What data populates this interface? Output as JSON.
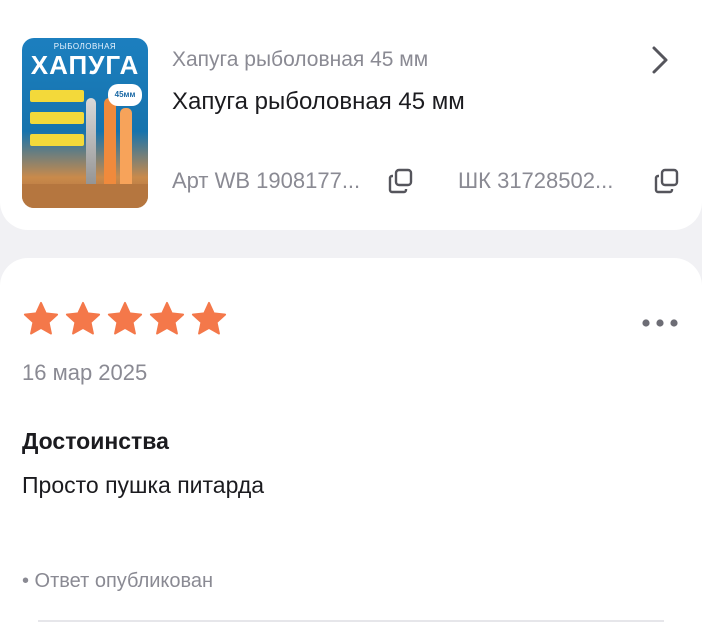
{
  "product": {
    "image_alt_brand_top": "РЫБОЛОВНАЯ",
    "image_alt_brand": "ХАПУГА",
    "image_alt_size": "45мм",
    "subtitle": "Хапуга рыболовная 45 мм",
    "title": "Хапуга рыболовная 45 мм",
    "art_label": "Арт WB 1908177...",
    "shk_label": "ШК 31728502...",
    "chevron_icon": "chevron-right-icon",
    "copy_icon": "copy-icon"
  },
  "review": {
    "rating": 5,
    "rating_max": 5,
    "star_color": "#f4784a",
    "date": "16 мар 2025",
    "section_title": "Достоинства",
    "section_text": "Просто пушка питарда",
    "reply_status": "• Ответ опубликован",
    "more_icon": "more-horizontal-icon"
  }
}
